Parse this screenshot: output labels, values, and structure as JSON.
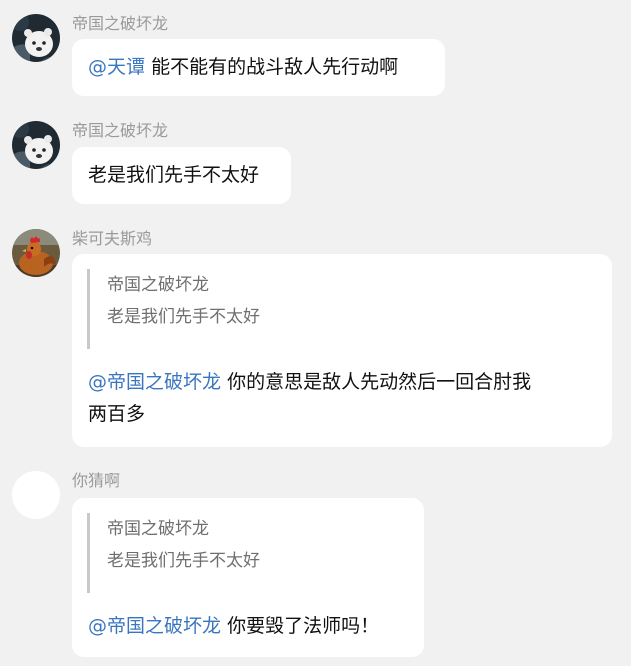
{
  "messages": [
    {
      "sender": "帝国之破坏龙",
      "avatar_icon": "white-bear-avatar-icon",
      "mention": "@天谭",
      "text": "能不能有的战斗敌人先行动啊"
    },
    {
      "sender": "帝国之破坏龙",
      "avatar_icon": "white-bear-avatar-icon",
      "text": "老是我们先手不太好"
    },
    {
      "sender": "柴可夫斯鸡",
      "avatar_icon": "rooster-avatar-icon",
      "quote": {
        "name": "帝国之破坏龙",
        "text": "老是我们先手不太好"
      },
      "mention": "@帝国之破坏龙",
      "text_line1": "你的意思是敌人先动然后一回合肘我",
      "text_line2": "两百多"
    },
    {
      "sender": "你猜啊",
      "avatar_icon": "blank-avatar-icon",
      "quote": {
        "name": "帝国之破坏龙",
        "text": "老是我们先手不太好"
      },
      "mention": "@帝国之破坏龙",
      "text": "你要毁了法师吗！"
    }
  ],
  "colors": {
    "background": "#f1f1f1",
    "bubble": "#ffffff",
    "mention": "#3a76c0",
    "sender_name": "#9a9a9a",
    "quote_bar": "#c9c9c9"
  }
}
